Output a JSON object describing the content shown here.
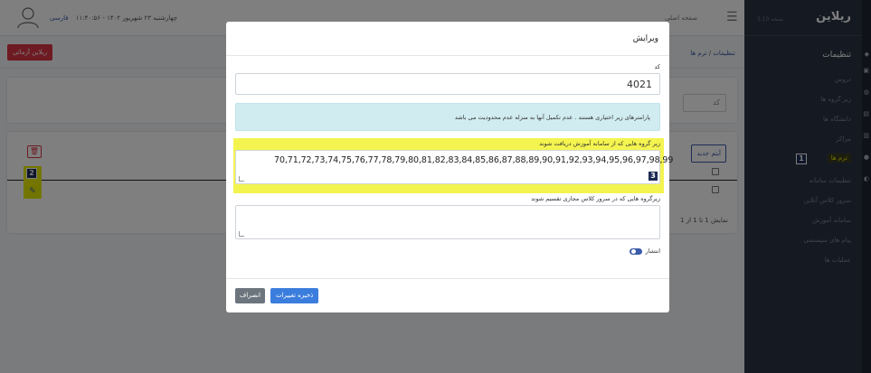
{
  "topbar": {
    "date": "چهارشنبه ۲۳ شهریور ۱۴۰۲ - ۱۱:۴۰:۵۶",
    "language": "فارسی",
    "home": "صفحه اصلی"
  },
  "subbar": {
    "action_button": "ریلاین آزمائی",
    "breadcrumb_root": "تنظیمات",
    "breadcrumb_separator": "/",
    "breadcrumb_current": "ترم ها"
  },
  "filter": {
    "code_placeholder": "کد"
  },
  "list": {
    "new_button": "آیتم جدید",
    "pagination": "نمایش 1 تا 1 از 1"
  },
  "markers": {
    "m1": "1",
    "m2": "2",
    "m3": "3"
  },
  "sidebar": {
    "brand": "ریلاین",
    "brand_sub": "نسخه 3.10",
    "section": "تنظیمات",
    "items": [
      {
        "label": "دروس",
        "active": false
      },
      {
        "label": "زیر گروه ها",
        "active": false
      },
      {
        "label": "دانشگاه ها",
        "active": false
      },
      {
        "label": "مراکز",
        "active": false
      },
      {
        "label": "ترم ها",
        "active": true
      },
      {
        "label": "تنظیمات سامانه",
        "active": false
      },
      {
        "label": "سرور کلاس آنلاین",
        "active": false
      },
      {
        "label": "سامانه آموزش",
        "active": false
      },
      {
        "label": "پیام های سیستمی",
        "active": false
      },
      {
        "label": "عملیات ها",
        "active": false
      }
    ]
  },
  "modal": {
    "title": "ویرایش",
    "code_label": "کد",
    "code_value": "4021",
    "info_alert": "پارامترهای زیر اختیاری هستند . عدم تکمیل آنها به منزله عدم محدودیت می باشد",
    "subgroups_label": "زیر گروه هایی که از سامانه آموزش دریافت شوند",
    "subgroups_value": "70,71,72,73,74,75,76,77,78,79,80,81,82,83,84,85,86,87,88,89,90,91,92,93,94,95,96,97,98,99",
    "virtual_label": "زیرگروه هایی که در سرور کلاس مجازی تقسیم شوند",
    "virtual_value": "",
    "publish_label": "انتشار",
    "publish_on": true,
    "save_button": "ذخیره تغییرات",
    "cancel_button": "انصراف"
  },
  "colors": {
    "primary": "#3b7ddd",
    "danger": "#dc3545",
    "highlight": "#f4f450",
    "sidebar_bg": "#2a3444"
  }
}
